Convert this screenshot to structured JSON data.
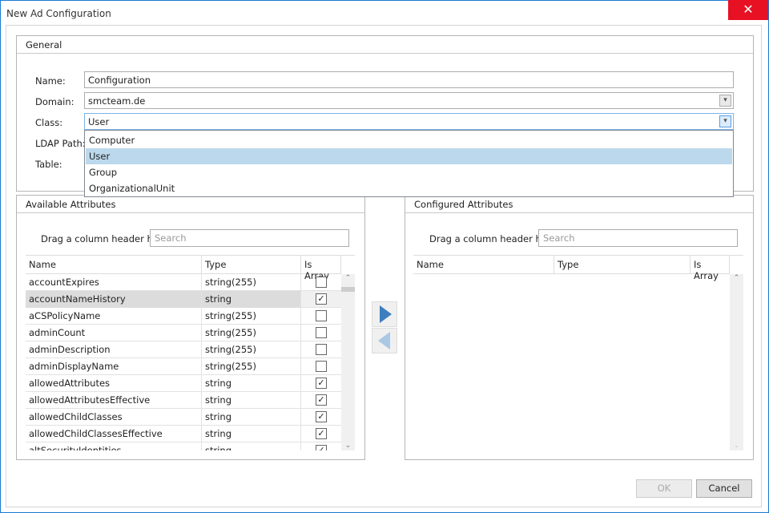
{
  "window": {
    "title": "New Ad Configuration",
    "close_icon": "close-icon"
  },
  "general": {
    "title": "General",
    "name_label": "Name:",
    "name_value": "Configuration",
    "domain_label": "Domain:",
    "domain_value": "smcteam.de",
    "class_label": "Class:",
    "class_value": "User",
    "ldap_label": "LDAP Path:",
    "table_label": "Table:",
    "class_options": [
      "Computer",
      "User",
      "Group",
      "OrganizationalUnit"
    ],
    "class_selected_index": 1
  },
  "available": {
    "title": "Available Attributes",
    "group_hint": "Drag a column header h...",
    "search_placeholder": "Search",
    "columns": [
      "Name",
      "Type",
      "Is Array"
    ],
    "rows": [
      {
        "name": "accountExpires",
        "type": "string(255)",
        "is_array": false
      },
      {
        "name": "accountNameHistory",
        "type": "string",
        "is_array": true
      },
      {
        "name": "aCSPolicyName",
        "type": "string(255)",
        "is_array": false
      },
      {
        "name": "adminCount",
        "type": "string(255)",
        "is_array": false
      },
      {
        "name": "adminDescription",
        "type": "string(255)",
        "is_array": false
      },
      {
        "name": "adminDisplayName",
        "type": "string(255)",
        "is_array": false
      },
      {
        "name": "allowedAttributes",
        "type": "string",
        "is_array": true
      },
      {
        "name": "allowedAttributesEffective",
        "type": "string",
        "is_array": true
      },
      {
        "name": "allowedChildClasses",
        "type": "string",
        "is_array": true
      },
      {
        "name": "allowedChildClassesEffective",
        "type": "string",
        "is_array": true
      },
      {
        "name": "altSecurityIdentities",
        "type": "string",
        "is_array": true
      }
    ],
    "selected_row": 1
  },
  "configured": {
    "title": "Configured Attributes",
    "group_hint": "Drag a column header h...",
    "search_placeholder": "Search",
    "columns": [
      "Name",
      "Type",
      "Is Array"
    ],
    "rows": []
  },
  "transfer": {
    "add_icon": "arrow-right-icon",
    "remove_icon": "arrow-left-icon",
    "add_color": "#3d7ebf",
    "remove_color": "#a9c8e4"
  },
  "buttons": {
    "ok": "OK",
    "cancel": "Cancel"
  }
}
